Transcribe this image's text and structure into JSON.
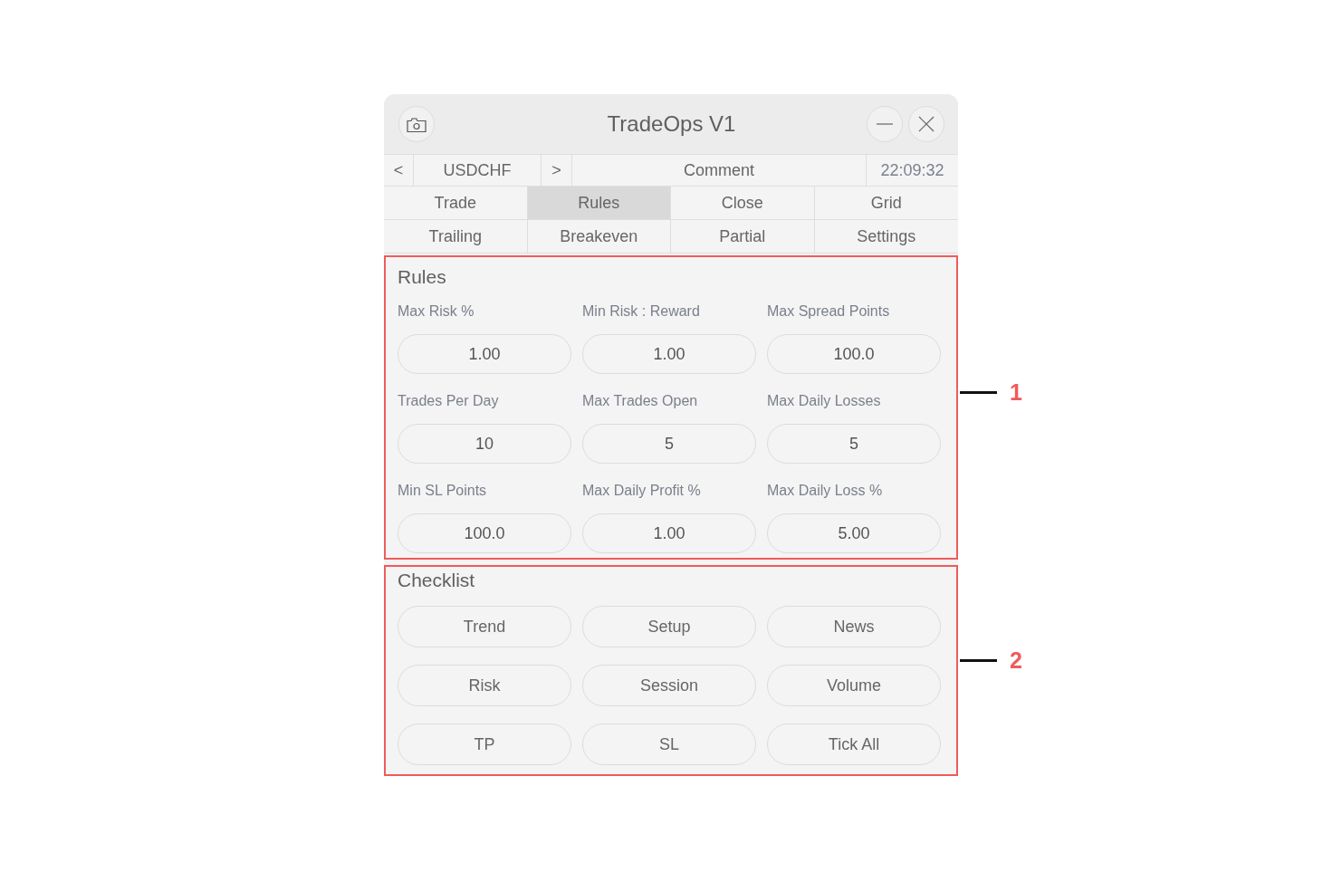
{
  "window": {
    "title": "TradeOps V1"
  },
  "symbol_bar": {
    "prev_label": "<",
    "symbol": "USDCHF",
    "next_label": ">",
    "comment": {
      "placeholder": "Comment"
    },
    "time": "22:09:32"
  },
  "tabs": [
    {
      "label": "Trade",
      "selected": false
    },
    {
      "label": "Rules",
      "selected": true
    },
    {
      "label": "Close",
      "selected": false
    },
    {
      "label": "Grid",
      "selected": false
    },
    {
      "label": "Trailing",
      "selected": false
    },
    {
      "label": "Breakeven",
      "selected": false
    },
    {
      "label": "Partial",
      "selected": false
    },
    {
      "label": "Settings",
      "selected": false
    }
  ],
  "sections": [
    {
      "kind": "fields",
      "title": "Rules",
      "callout": "1",
      "fields": [
        {
          "label": "Max Risk %",
          "value": "1.00"
        },
        {
          "label": "Min Risk : Reward",
          "value": "1.00"
        },
        {
          "label": "Max Spread Points",
          "value": "100.0"
        },
        {
          "label": "Trades Per Day",
          "value": "10"
        },
        {
          "label": "Max Trades Open",
          "value": "5"
        },
        {
          "label": "Max Daily Losses",
          "value": "5"
        },
        {
          "label": "Min SL Points",
          "value": "100.0"
        },
        {
          "label": "Max Daily Profit %",
          "value": "1.00"
        },
        {
          "label": "Max Daily Loss %",
          "value": "5.00"
        }
      ]
    },
    {
      "kind": "buttons",
      "title": "Checklist",
      "callout": "2",
      "buttons": [
        "Trend",
        "Setup",
        "News",
        "Risk",
        "Session",
        "Volume",
        "TP",
        "SL",
        "Tick All"
      ]
    }
  ]
}
